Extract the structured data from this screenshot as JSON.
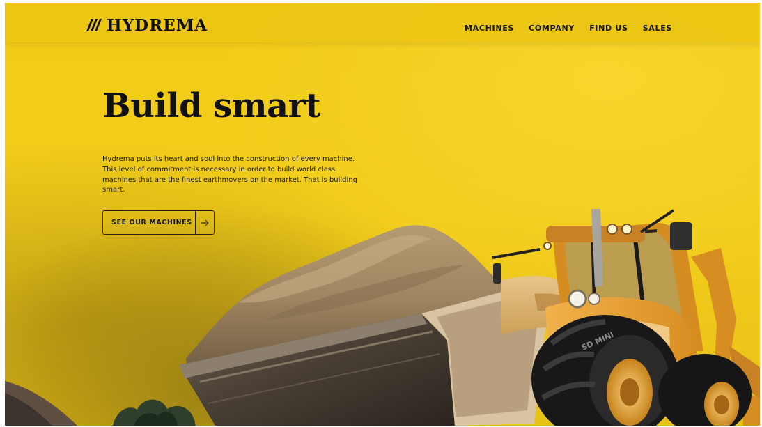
{
  "brand": {
    "name": "HYDREMA",
    "logo_icon": "diagonal-stripes-icon"
  },
  "nav": {
    "items": [
      {
        "label": "MACHINES"
      },
      {
        "label": "COMPANY"
      },
      {
        "label": "FIND US"
      },
      {
        "label": "SALES"
      }
    ]
  },
  "hero": {
    "title": "Build smart",
    "body": "Hydrema puts its heart and soul into the construction of every machine. This level of commitment is necessary in order to build world class machines that are the finest earthmovers on the market. That is building smart.",
    "cta_label": "SEE OUR MACHINES",
    "cta_icon": "arrow-right-icon"
  },
  "image": {
    "subject": "backhoe-loader",
    "tire_text": "SD MINI"
  },
  "colors": {
    "brand_yellow": "#f2cd18",
    "text_dark": "#111111",
    "machine_orange": "#d59a2b"
  }
}
